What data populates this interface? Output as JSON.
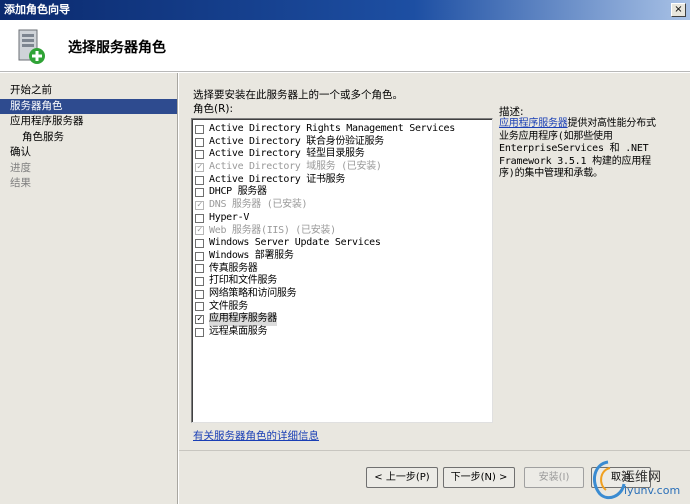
{
  "window": {
    "title": "添加角色向导",
    "close_glyph": "×"
  },
  "header": {
    "title": "选择服务器角色",
    "icon": "server-add-icon"
  },
  "nav": [
    {
      "label": "开始之前",
      "state": "normal"
    },
    {
      "label": "服务器角色",
      "state": "active"
    },
    {
      "label": "应用程序服务器",
      "state": "normal"
    },
    {
      "label": "角色服务",
      "state": "sub"
    },
    {
      "label": "确认",
      "state": "normal"
    },
    {
      "label": "进度",
      "state": "disabled"
    },
    {
      "label": "结果",
      "state": "disabled"
    }
  ],
  "main": {
    "instruction": "选择要安装在此服务器上的一个或多个角色。",
    "roles_label": "角色(R):",
    "roles": [
      {
        "label": "Active Directory Rights Management Services",
        "checked": false,
        "disabled": false
      },
      {
        "label": "Active Directory 联合身份验证服务",
        "checked": false,
        "disabled": false
      },
      {
        "label": "Active Directory 轻型目录服务",
        "checked": false,
        "disabled": false
      },
      {
        "label": "Active Directory 域服务  (已安装)",
        "checked": true,
        "disabled": true
      },
      {
        "label": "Active Directory 证书服务",
        "checked": false,
        "disabled": false
      },
      {
        "label": "DHCP 服务器",
        "checked": false,
        "disabled": false
      },
      {
        "label": "DNS 服务器  (已安装)",
        "checked": true,
        "disabled": true
      },
      {
        "label": "Hyper-V",
        "checked": false,
        "disabled": false
      },
      {
        "label": "Web 服务器(IIS)  (已安装)",
        "checked": true,
        "disabled": true
      },
      {
        "label": "Windows Server Update Services",
        "checked": false,
        "disabled": false
      },
      {
        "label": "Windows 部署服务",
        "checked": false,
        "disabled": false
      },
      {
        "label": "传真服务器",
        "checked": false,
        "disabled": false
      },
      {
        "label": "打印和文件服务",
        "checked": false,
        "disabled": false
      },
      {
        "label": "网络策略和访问服务",
        "checked": false,
        "disabled": false
      },
      {
        "label": "文件服务",
        "checked": false,
        "disabled": false
      },
      {
        "label": "应用程序服务器",
        "checked": true,
        "disabled": false,
        "selected": true
      },
      {
        "label": "远程桌面服务",
        "checked": false,
        "disabled": false
      }
    ],
    "description": {
      "title": "描述:",
      "link": "应用程序服务器",
      "text": "提供对高性能分布式业务应用程序(如那些使用 EnterpriseServices 和 .NET Framework 3.5.1 构建的应用程序)的集中管理和承载。"
    },
    "more_info_link": "有关服务器角色的详细信息"
  },
  "footer": {
    "back": "< 上一步(P)",
    "next": "下一步(N) >",
    "install": "安装(I)",
    "cancel": "取消"
  },
  "watermark": {
    "brand": "运维网",
    "site": "iyunv.com"
  },
  "colors": {
    "active_nav": "#2e4b8f",
    "link": "#1a3fb5",
    "panel": "#e9e7e0"
  }
}
